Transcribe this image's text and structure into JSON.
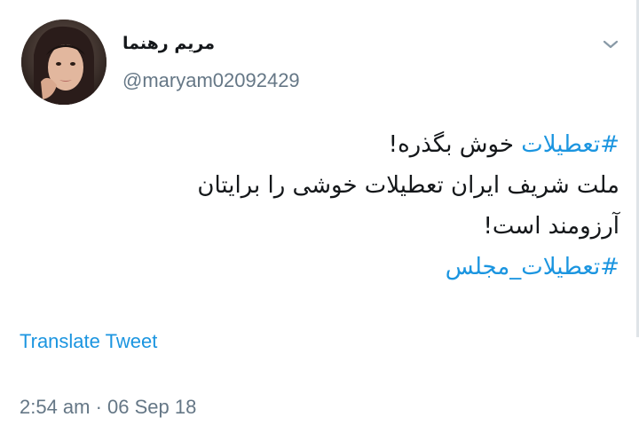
{
  "author": {
    "display_name": "مریم رهنما",
    "handle": "@maryam02092429",
    "avatar_icon": "profile-photo"
  },
  "menu": {
    "icon": "chevron-down-icon"
  },
  "tweet": {
    "line1_hashtag": "#تعطیلات",
    "line1_text": " خوش بگذره!",
    "line2_text": "ملت شریف ایران تعطیلات خوشی را برایتان",
    "line3_text": "آرزومند است!",
    "line4_hashtag": "#تعطیلات_مجلس"
  },
  "actions": {
    "translate_label": "Translate Tweet"
  },
  "meta": {
    "timestamp": "2:54 am · 06 Sep 18"
  },
  "colors": {
    "link": "#1b95e0",
    "secondary_text": "#657786",
    "primary_text": "#14171a"
  }
}
